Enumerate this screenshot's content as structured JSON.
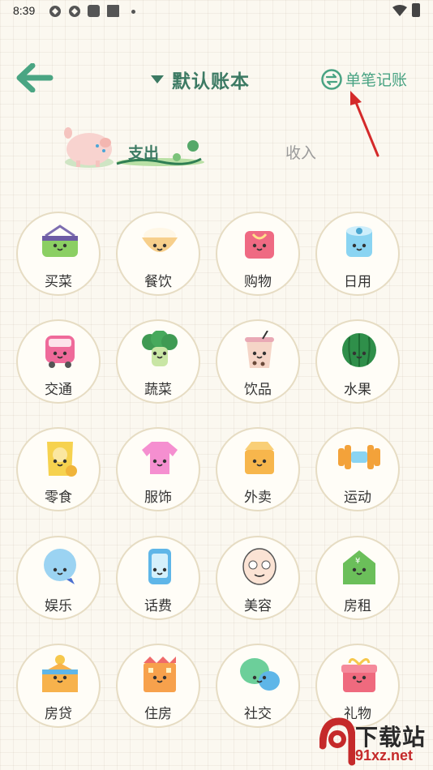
{
  "status_bar": {
    "time": "8:39"
  },
  "header": {
    "book_title": "默认账本",
    "single_entry_label": "单笔记账"
  },
  "tabs": [
    {
      "label": "支出",
      "active": true
    },
    {
      "label": "收入",
      "active": false
    }
  ],
  "categories": [
    {
      "label": "买菜",
      "icon": "basket-icon"
    },
    {
      "label": "餐饮",
      "icon": "rice-bowl-icon"
    },
    {
      "label": "购物",
      "icon": "shopping-bag-icon"
    },
    {
      "label": "日用",
      "icon": "toilet-paper-icon"
    },
    {
      "label": "交通",
      "icon": "bus-icon"
    },
    {
      "label": "蔬菜",
      "icon": "broccoli-icon"
    },
    {
      "label": "饮品",
      "icon": "bubble-tea-icon"
    },
    {
      "label": "水果",
      "icon": "watermelon-icon"
    },
    {
      "label": "零食",
      "icon": "chips-bag-icon"
    },
    {
      "label": "服饰",
      "icon": "tshirt-icon"
    },
    {
      "label": "外卖",
      "icon": "takeout-box-icon"
    },
    {
      "label": "运动",
      "icon": "dumbbell-icon"
    },
    {
      "label": "娱乐",
      "icon": "balloon-icon"
    },
    {
      "label": "话费",
      "icon": "phone-icon"
    },
    {
      "label": "美容",
      "icon": "face-mask-icon"
    },
    {
      "label": "房租",
      "icon": "rent-house-icon"
    },
    {
      "label": "房贷",
      "icon": "mortgage-house-icon"
    },
    {
      "label": "住房",
      "icon": "building-icon"
    },
    {
      "label": "社交",
      "icon": "chat-bubbles-icon"
    },
    {
      "label": "礼物",
      "icon": "gift-icon"
    }
  ],
  "colors": {
    "primary": "#3c7a63",
    "accent": "#49a383",
    "annotation_arrow": "#d42a2a"
  },
  "watermark": {
    "line1": "下载站",
    "line2": "91xz.net"
  }
}
